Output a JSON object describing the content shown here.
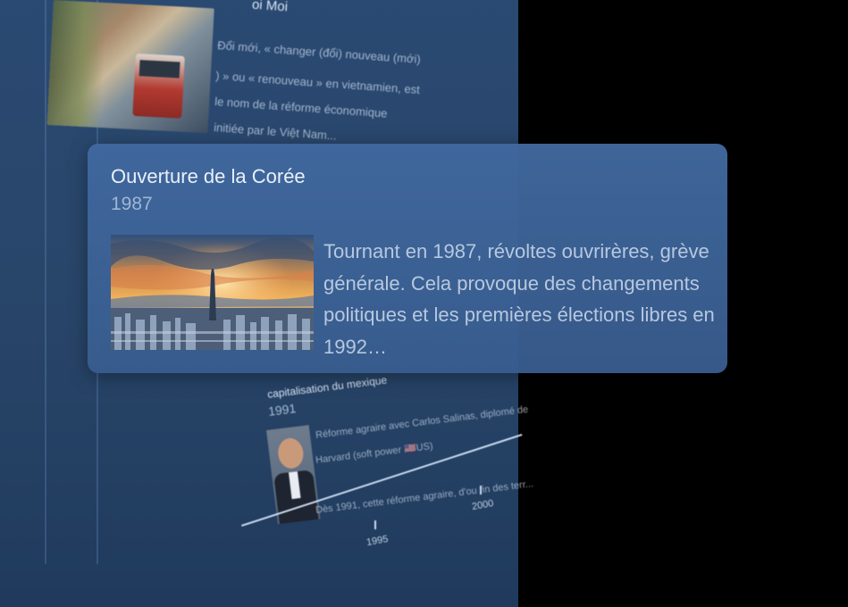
{
  "background": {
    "entry_top": {
      "title_fragment": "oi Moi",
      "lines": [
        "Đổi mới, « changer (đổi) nouveau (mới)",
        ") » ou « renouveau » en vietnamien, est",
        "le nom de la réforme économique",
        "initiée par le Việt Nam..."
      ]
    },
    "entry_bottom": {
      "title": "capitalisation du mexique",
      "year": "1991",
      "lines": [
        "Réforme agraire avec Carlos Salinas, diplomé de",
        "Harvard (soft power 🇺🇸US)",
        "",
        "Dès 1991, cette réforme agraire, d'ou fin des terr..."
      ]
    },
    "axis_labels": [
      "1995",
      "2000"
    ]
  },
  "card": {
    "title": "Ouverture de la Corée",
    "year": "1987",
    "description": "Tournant en 1987, révoltes ouvrirères, grève générale. Cela provoque des changements politiques et les premières élections libres en 1992…",
    "image_icon": "seoul-skyline-photo"
  },
  "colors": {
    "panel": "#2b4a73",
    "card": "#40689e",
    "card_title": "#e9f0fa",
    "card_year": "#9fb6d4",
    "card_desc": "#b7c8df",
    "backdrop": "#000000"
  }
}
